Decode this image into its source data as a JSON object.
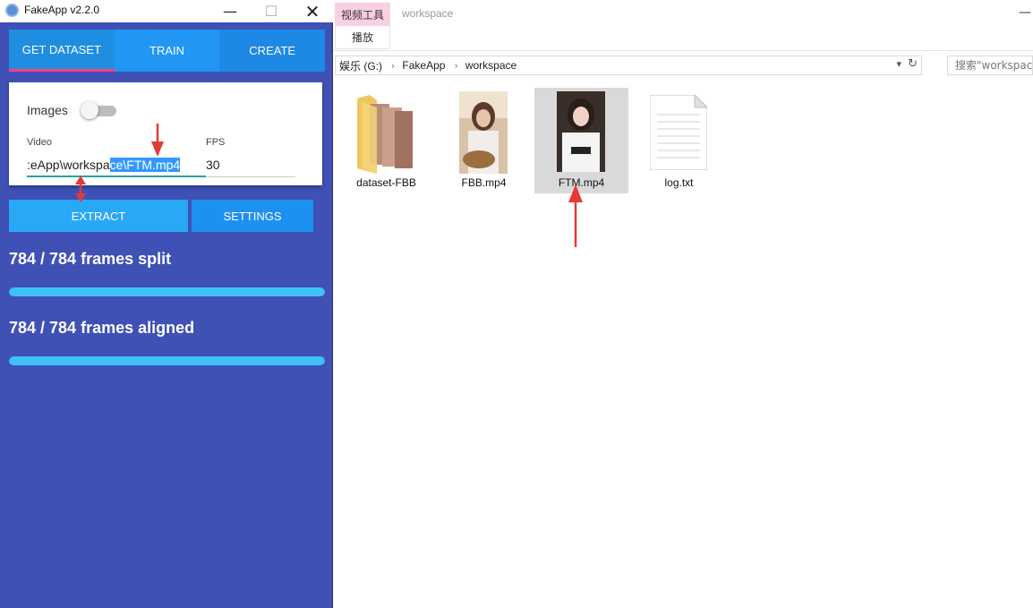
{
  "app": {
    "title": "FakeApp v2.2.0",
    "window_controls": {
      "minimize": "—",
      "maximize": "☐",
      "close": "✕"
    },
    "tabs": [
      {
        "label": "GET DATASET",
        "active": true
      },
      {
        "label": "TRAIN",
        "active": false
      },
      {
        "label": "CREATE",
        "active": false
      }
    ],
    "images_label": "Images",
    "images_toggle_on": false,
    "video_label": "Video",
    "video_value_plain": ":eApp\\workspa",
    "video_value_selected": "ce\\FTM.mp4",
    "fps_label": "FPS",
    "fps_value": "30",
    "extract_label": "EXTRACT",
    "settings_label": "SETTINGS",
    "split_status": "784 / 784 frames split",
    "split_progress": 1.0,
    "aligned_status": "784 / 784 frames aligned",
    "aligned_progress": 1.0,
    "colors": {
      "background": "#3f51b5",
      "accent": "#2196f3",
      "progress": "#3fc1f7",
      "tab_indicator": "#ff4081",
      "arrow": "#e53935"
    }
  },
  "explorer": {
    "ribbon_context_tab": "视频工具",
    "ribbon_play_tab": "播放",
    "title": "workspace",
    "breadcrumb": [
      "娱乐 (G:)",
      "FakeApp",
      "workspace"
    ],
    "search_placeholder": "搜索\"workspace\"",
    "files": [
      {
        "name": "dataset-FBB",
        "type": "folder",
        "selected": false
      },
      {
        "name": "FBB.mp4",
        "type": "video",
        "selected": false
      },
      {
        "name": "FTM.mp4",
        "type": "video",
        "selected": true
      },
      {
        "name": "log.txt",
        "type": "text",
        "selected": false
      }
    ]
  }
}
